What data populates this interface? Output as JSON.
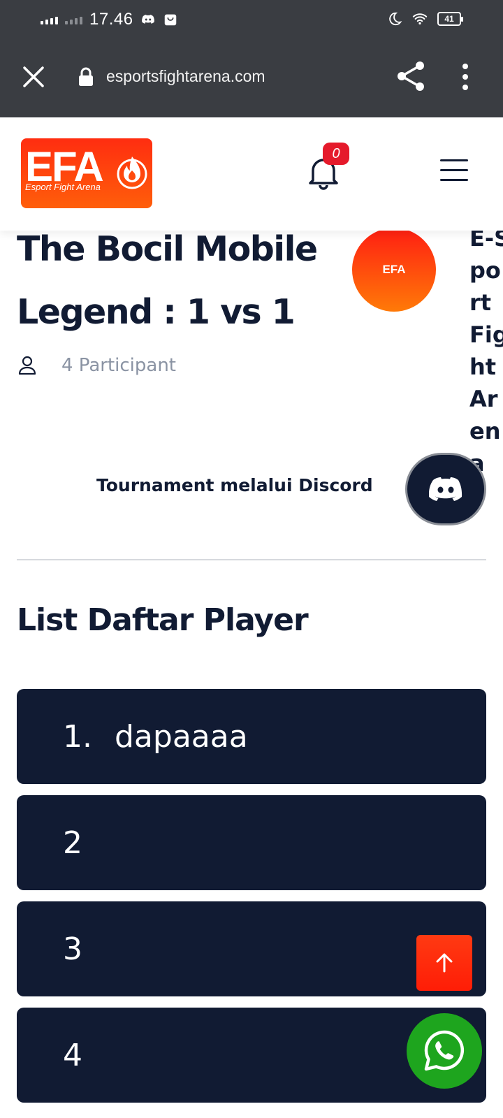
{
  "status_bar": {
    "time": "17.46",
    "battery": "41",
    "icons": [
      "signal-icon",
      "signal-icon",
      "discord-notification-icon",
      "bag-notification-icon",
      "moon-icon",
      "wifi-icon",
      "battery-icon"
    ]
  },
  "browser": {
    "url": "esportsfightarena.com",
    "icons": [
      "close-icon",
      "lock-icon",
      "share-icon",
      "more-vertical-icon"
    ]
  },
  "header": {
    "logo_text": "EFA",
    "logo_subtext": "Esport Fight Arena",
    "notification_count": "0",
    "icons": [
      "bell-icon",
      "hamburger-menu-icon"
    ]
  },
  "tournament": {
    "title": "The Bocil Mobile Legend : 1 vs 1",
    "organizer_logo_text": "EFA",
    "organizer_name": "E-Sport Fight Arena",
    "participants": "4 Participant",
    "discord_label": "Tournament melalui Discord"
  },
  "player_list": {
    "title": "List Daftar Player",
    "players": [
      {
        "number": "1.",
        "name": "dapaaaa"
      },
      {
        "number": "2",
        "name": ""
      },
      {
        "number": "3",
        "name": ""
      },
      {
        "number": "4",
        "name": ""
      }
    ]
  },
  "colors": {
    "navy": "#111b33",
    "brand_orange": "#ff3a12",
    "whatsapp_green": "#1ea51e",
    "badge_red": "#e51a2b"
  }
}
